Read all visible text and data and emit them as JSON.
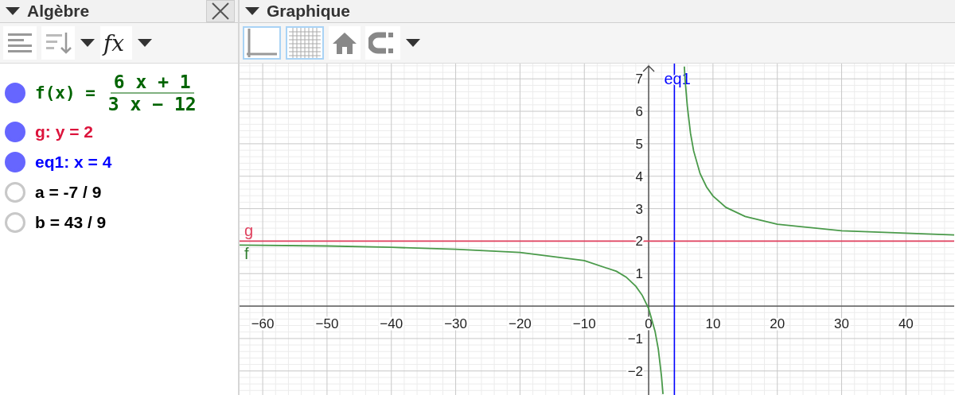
{
  "algebra": {
    "title": "Algèbre",
    "toolbar": [
      {
        "kind": "description"
      },
      {
        "kind": "sort",
        "dropdown": true
      },
      {
        "kind": "input",
        "label": "fx",
        "dropdown": true
      }
    ],
    "items": [
      {
        "kind": "fraction",
        "label": "f(x) =",
        "numerator": "6 x + 1",
        "denominator": "3 x − 12",
        "color": "#006400",
        "visible": true
      },
      {
        "kind": "plain",
        "label": "g: y = 2",
        "color": "#dc143c",
        "visible": true
      },
      {
        "kind": "plain",
        "label": "eq1: x = 4",
        "color": "#0000ff",
        "visible": true
      },
      {
        "kind": "plain",
        "label": "a = -7 / 9",
        "color": "#000000",
        "visible": false
      },
      {
        "kind": "plain",
        "label": "b = 43 / 9",
        "color": "#000000",
        "visible": false
      }
    ]
  },
  "graphics": {
    "title": "Graphique",
    "toolbar": [
      {
        "kind": "axes",
        "selected": true
      },
      {
        "kind": "grid",
        "selected": true
      },
      {
        "kind": "home",
        "selected": false
      },
      {
        "kind": "magnet",
        "selected": false
      }
    ],
    "chart_data": {
      "type": "line",
      "grid": true,
      "xlim": [
        -63.6,
        47.5
      ],
      "ylim": [
        -2.74,
        7.47
      ],
      "xticks": [
        {
          "value": -60,
          "label": "−60"
        },
        {
          "value": -50,
          "label": "−50"
        },
        {
          "value": -40,
          "label": "−40"
        },
        {
          "value": -30,
          "label": "−30"
        },
        {
          "value": -20,
          "label": "−20"
        },
        {
          "value": -10,
          "label": "−10"
        },
        0,
        10,
        20,
        30,
        40
      ],
      "yticks": [
        {
          "value": -2,
          "label": "−2"
        },
        {
          "value": -1,
          "label": "−1"
        },
        1,
        2,
        3,
        4,
        5,
        6,
        7
      ],
      "x": [
        -63.6,
        -50,
        -40,
        -30,
        -20,
        -10,
        -5,
        -3.5,
        -2,
        -1,
        0,
        1,
        1.5,
        2,
        2.2,
        2.23,
        4,
        5.55,
        5.6,
        5.7,
        6,
        6.5,
        7,
        8,
        9,
        10,
        12,
        15,
        20,
        30,
        47.5
      ],
      "series": [
        {
          "name": "f",
          "color": "#4a9a4a",
          "values": [
            1.88,
            1.85,
            1.81,
            1.75,
            1.65,
            1.4,
            1.07,
            0.89,
            0.61,
            0.33,
            -0.08,
            -0.78,
            -1.33,
            -2.17,
            -2.63,
            -2.71,
            null,
            7.38,
            7.21,
            6.9,
            6.17,
            5.33,
            4.78,
            4.08,
            3.67,
            3.39,
            3.04,
            2.76,
            2.52,
            2.32,
            2.19
          ]
        },
        {
          "name": "g",
          "color": "#e0405e",
          "values": [
            2,
            2,
            2,
            2,
            2,
            2,
            2,
            2,
            2,
            2,
            2,
            2,
            2,
            2,
            2,
            2,
            2,
            2,
            2,
            2,
            2,
            2,
            2,
            2,
            2,
            2,
            2,
            2,
            2,
            2,
            2
          ]
        }
      ],
      "ref_lines": [
        {
          "axis": "x",
          "value": 4,
          "label": "eq1",
          "color": "#0000ff"
        }
      ]
    }
  }
}
